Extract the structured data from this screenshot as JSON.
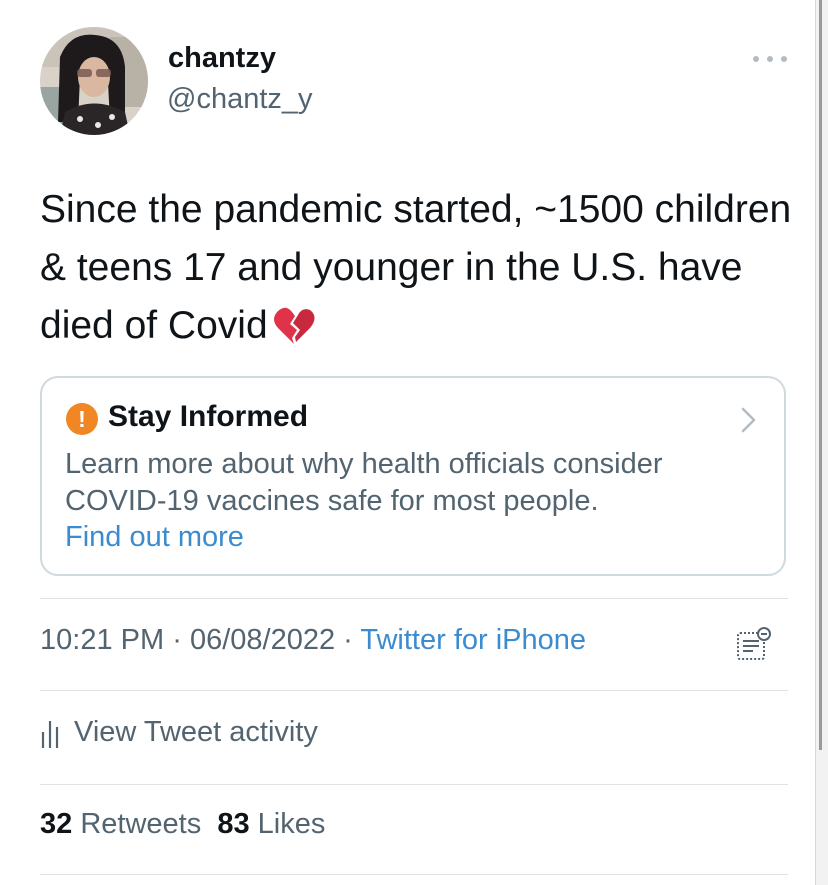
{
  "author": {
    "display_name": "chantzy",
    "handle": "@chantz_y"
  },
  "tweet": {
    "text": "Since the pandemic started, ~1500 children & teens 17 and younger in the U.S. have died of Covid",
    "emoji": "broken-heart-icon"
  },
  "notice": {
    "title": "Stay Informed",
    "body": "Learn more about why health officials consider COVID-19 vaccines safe for most people.",
    "link": "Find out more",
    "icon": "alert-icon",
    "icon_color": "#f18624"
  },
  "meta": {
    "time": "10:21 PM",
    "separator": "·",
    "date": "06/08/2022",
    "source": "Twitter for iPhone"
  },
  "activity": {
    "label": "View Tweet activity"
  },
  "stats": {
    "retweets_count": "32",
    "retweets_label": "Retweets",
    "likes_count": "83",
    "likes_label": "Likes"
  },
  "colors": {
    "link": "#3b8bd0",
    "secondary_text": "#536471",
    "primary_text": "#0f1419",
    "card_border": "#cfd9de"
  }
}
